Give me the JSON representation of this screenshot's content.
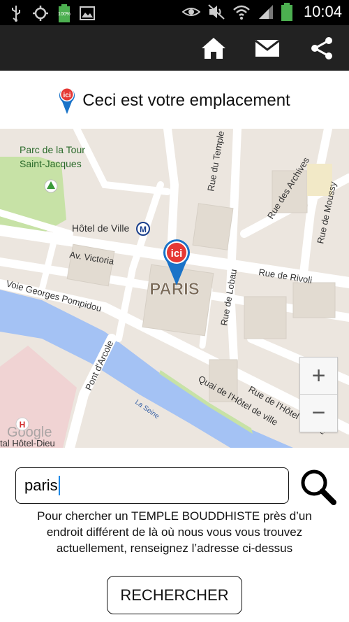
{
  "status_bar": {
    "battery_text": "100%",
    "time": "10:04",
    "icons": [
      "usb-icon",
      "gps-icon",
      "battery-icon",
      "image-icon",
      "eye-icon",
      "mute-icon",
      "wifi-icon",
      "signal-icon",
      "battery-full-icon"
    ]
  },
  "action_bar": {
    "icons": [
      "home-icon",
      "mail-icon",
      "share-icon"
    ],
    "background": "#222222"
  },
  "header": {
    "pin_label": "ici",
    "title": "Ceci est votre emplacement"
  },
  "map": {
    "marker_label": "ici",
    "city_label": "PARIS",
    "labels": {
      "parc": "Parc de la Tour",
      "parc2": "Saint-Jacques",
      "hotel_de_ville": "Hôtel de Ville",
      "metro": "M",
      "av_victoria": "Av. Victoria",
      "rue_de_rivoli": "Rue de Rivoli",
      "voie": "Voie Georges Pompidou",
      "pont": "Pont d'Arcole",
      "seine": "La Seine",
      "quai": "Quai de l'Hôtel de ville",
      "rue_temple": "Rue du Temple",
      "rue_archives": "Rue des Archives",
      "rue_moussy": "Rue de Moussy",
      "rue_lobau": "Rue de Lobau",
      "rue_hotel_ville": "Rue de l'Hôtel de ville",
      "hopital": "tal Hôtel-Dieu",
      "hospital_mark": "H",
      "google": "Google"
    },
    "zoom_in": "+",
    "zoom_out": "−",
    "colors": {
      "water": "#a4c2f4",
      "park": "#c7e2a6",
      "road": "#ffffff",
      "block": "#ece6df",
      "hospital_zone": "#f0d3d3"
    }
  },
  "search": {
    "value": "paris",
    "icon": "search-icon"
  },
  "help_text": {
    "line1": "Pour chercher un TEMPLE BOUDDHISTE près d’un",
    "line2": "endroit différent de là où nous vous vous trouvez",
    "line3": "actuellement, renseignez l’adresse ci-dessus"
  },
  "button": {
    "label": "RECHERCHER"
  }
}
